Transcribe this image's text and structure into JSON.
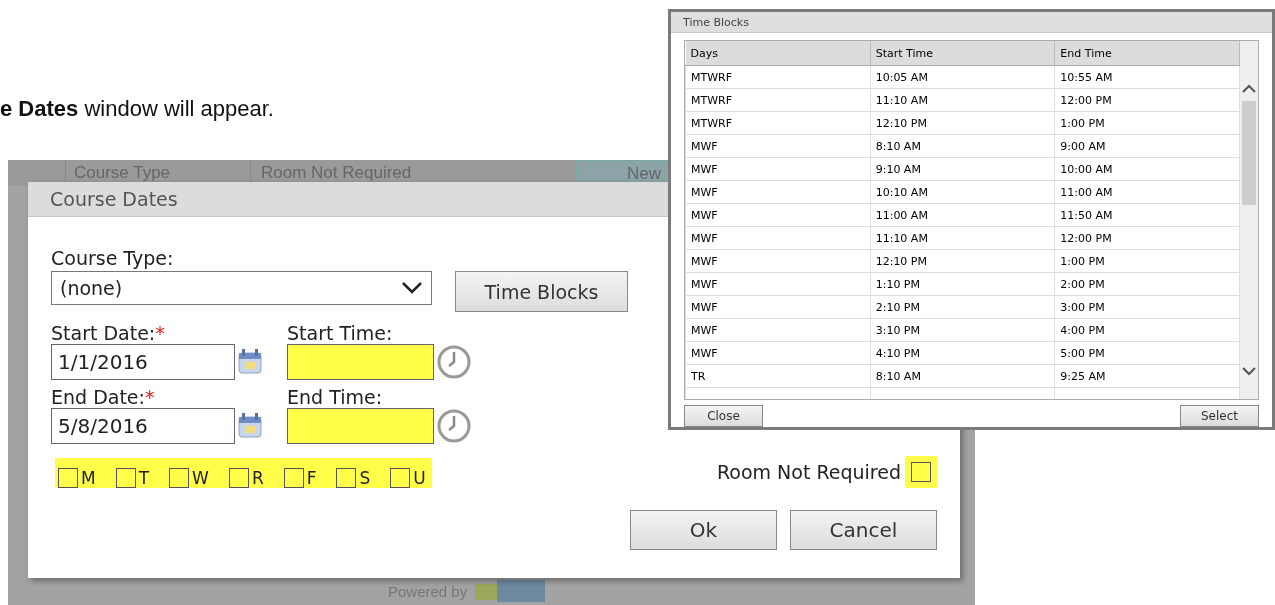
{
  "intro": "**e Dates** window will appear.",
  "background": {
    "header_labels": [
      "Course Type",
      "Room Not Required",
      "New"
    ],
    "footer": "Powered by"
  },
  "course_dates": {
    "title": "Course Dates",
    "course_type": {
      "label": "Course Type:",
      "value": "(none)"
    },
    "time_blocks_button": "Time Blocks",
    "start_date": {
      "label": "Start Date:",
      "required_mark": "*",
      "value": "1/1/2016"
    },
    "start_time": {
      "label": "Start Time:",
      "highlighted": true
    },
    "end_date": {
      "label": "End Date:",
      "required_mark": "*",
      "value": "5/8/2016"
    },
    "end_time": {
      "label": "End Time:",
      "highlighted": true
    },
    "days_highlighted": true,
    "days": [
      {
        "label": "M",
        "checked": false
      },
      {
        "label": "T",
        "checked": false
      },
      {
        "label": "W",
        "checked": false
      },
      {
        "label": "R",
        "checked": false
      },
      {
        "label": "F",
        "checked": false
      },
      {
        "label": "S",
        "checked": false
      },
      {
        "label": "U",
        "checked": false
      }
    ],
    "room_not_required": {
      "label": "Room Not Required",
      "checked": false,
      "highlighted": true
    },
    "buttons": [
      "Ok",
      "Cancel"
    ]
  },
  "time_blocks": {
    "title": "Time Blocks",
    "columns": [
      "Days",
      "Start Time",
      "End Time"
    ],
    "rows": [
      [
        "MTWRF",
        "10:05 AM",
        "10:55 AM"
      ],
      [
        "MTWRF",
        "11:10 AM",
        "12:00 PM"
      ],
      [
        "MTWRF",
        "12:10 PM",
        "1:00 PM"
      ],
      [
        "MWF",
        "8:10 AM",
        "9:00 AM"
      ],
      [
        "MWF",
        "9:10 AM",
        "10:00 AM"
      ],
      [
        "MWF",
        "10:10 AM",
        "11:00 AM"
      ],
      [
        "MWF",
        "11:00 AM",
        "11:50 AM"
      ],
      [
        "MWF",
        "11:10 AM",
        "12:00 PM"
      ],
      [
        "MWF",
        "12:10 PM",
        "1:00 PM"
      ],
      [
        "MWF",
        "1:10 PM",
        "2:00 PM"
      ],
      [
        "MWF",
        "2:10 PM",
        "3:00 PM"
      ],
      [
        "MWF",
        "3:10 PM",
        "4:00 PM"
      ],
      [
        "MWF",
        "4:10 PM",
        "5:00 PM"
      ],
      [
        "TR",
        "8:10 AM",
        "9:25 AM"
      ]
    ],
    "buttons": [
      "Close",
      "Select"
    ]
  }
}
